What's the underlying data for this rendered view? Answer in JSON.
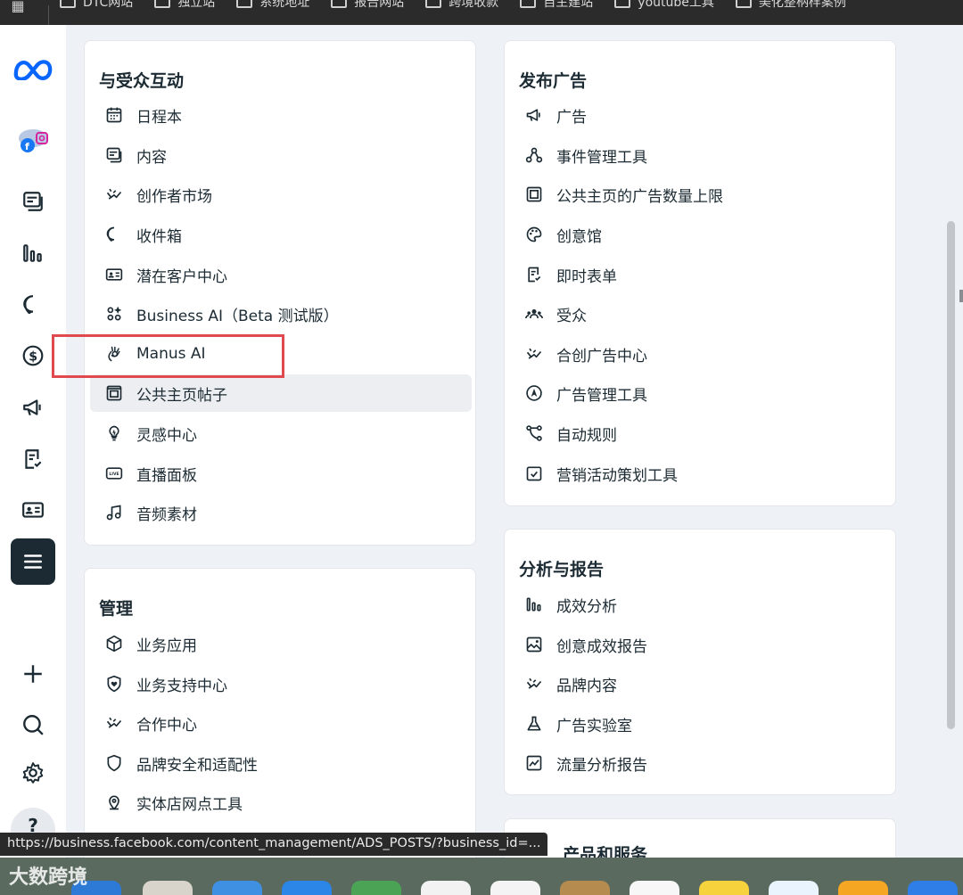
{
  "bookmarks": {
    "items": [
      {
        "label": "DTC网站"
      },
      {
        "label": "独立站"
      },
      {
        "label": "系统地址"
      },
      {
        "label": "报告网站"
      },
      {
        "label": "跨境收款"
      },
      {
        "label": "自主建站"
      },
      {
        "label": "youtube工具"
      },
      {
        "label": "美化整柄样案例"
      }
    ]
  },
  "rail": {
    "logo": "meta-logo-icon",
    "items": [
      "accounts-icon",
      "content-icon",
      "insights-icon",
      "inbox-icon",
      "billing-icon",
      "ads-icon",
      "forms-icon",
      "id-card-icon",
      "all-tools-icon",
      "add-icon",
      "search-icon",
      "settings-icon",
      "help-icon"
    ],
    "help_label": "?"
  },
  "cards": {
    "engage": {
      "title": "与受众互动",
      "items": [
        {
          "label": "日程本",
          "icon": "calendar-icon"
        },
        {
          "label": "内容",
          "icon": "content-icon"
        },
        {
          "label": "创作者市场",
          "icon": "handshake-icon"
        },
        {
          "label": "收件箱",
          "icon": "inbox-icon"
        },
        {
          "label": "潜在客户中心",
          "icon": "id-card-icon"
        },
        {
          "label": "Business AI（Beta 测试版）",
          "icon": "grid-sparkle-icon"
        },
        {
          "label": "Manus AI",
          "icon": "manus-hand-icon"
        },
        {
          "label": "公共主页帖子",
          "icon": "page-posts-icon"
        },
        {
          "label": "灵感中心",
          "icon": "lightbulb-icon"
        },
        {
          "label": "直播面板",
          "icon": "live-icon"
        },
        {
          "label": "音频素材",
          "icon": "music-note-icon"
        }
      ]
    },
    "manage": {
      "title": "管理",
      "items": [
        {
          "label": "业务应用",
          "icon": "cube-icon"
        },
        {
          "label": "业务支持中心",
          "icon": "shield-heart-icon"
        },
        {
          "label": "合作中心",
          "icon": "handshake-icon"
        },
        {
          "label": "品牌安全和适配性",
          "icon": "shield-icon"
        },
        {
          "label": "实体店网点工具",
          "icon": "location-pin-icon"
        }
      ]
    },
    "advertise": {
      "title": "发布广告",
      "items": [
        {
          "label": "广告",
          "icon": "megaphone-icon"
        },
        {
          "label": "事件管理工具",
          "icon": "nodes-icon"
        },
        {
          "label": "公共主页的广告数量上限",
          "icon": "frame-icon"
        },
        {
          "label": "创意馆",
          "icon": "palette-icon"
        },
        {
          "label": "即时表单",
          "icon": "form-icon"
        },
        {
          "label": "受众",
          "icon": "audience-icon"
        },
        {
          "label": "合创广告中心",
          "icon": "handshake-icon"
        },
        {
          "label": "广告管理工具",
          "icon": "navigation-icon"
        },
        {
          "label": "自动规则",
          "icon": "branch-icon"
        },
        {
          "label": "营销活动策划工具",
          "icon": "checkbox-calendar-icon"
        }
      ]
    },
    "analyze": {
      "title": "分析与报告",
      "items": [
        {
          "label": "成效分析",
          "icon": "bar-chart-icon"
        },
        {
          "label": "创意成效报告",
          "icon": "image-icon"
        },
        {
          "label": "品牌内容",
          "icon": "handshake-icon"
        },
        {
          "label": "广告实验室",
          "icon": "flask-icon"
        },
        {
          "label": "流量分析报告",
          "icon": "line-chart-icon"
        }
      ]
    },
    "partial": {
      "title": "产品和服务"
    }
  },
  "status_url": "https://business.facebook.com/content_management/ADS_POSTS/?business_id=...",
  "watermark": "大数跨境",
  "colors": {
    "highlight": "#e0494d",
    "meta_blue": "#0866ff",
    "rail_active": "#1c2b33"
  }
}
